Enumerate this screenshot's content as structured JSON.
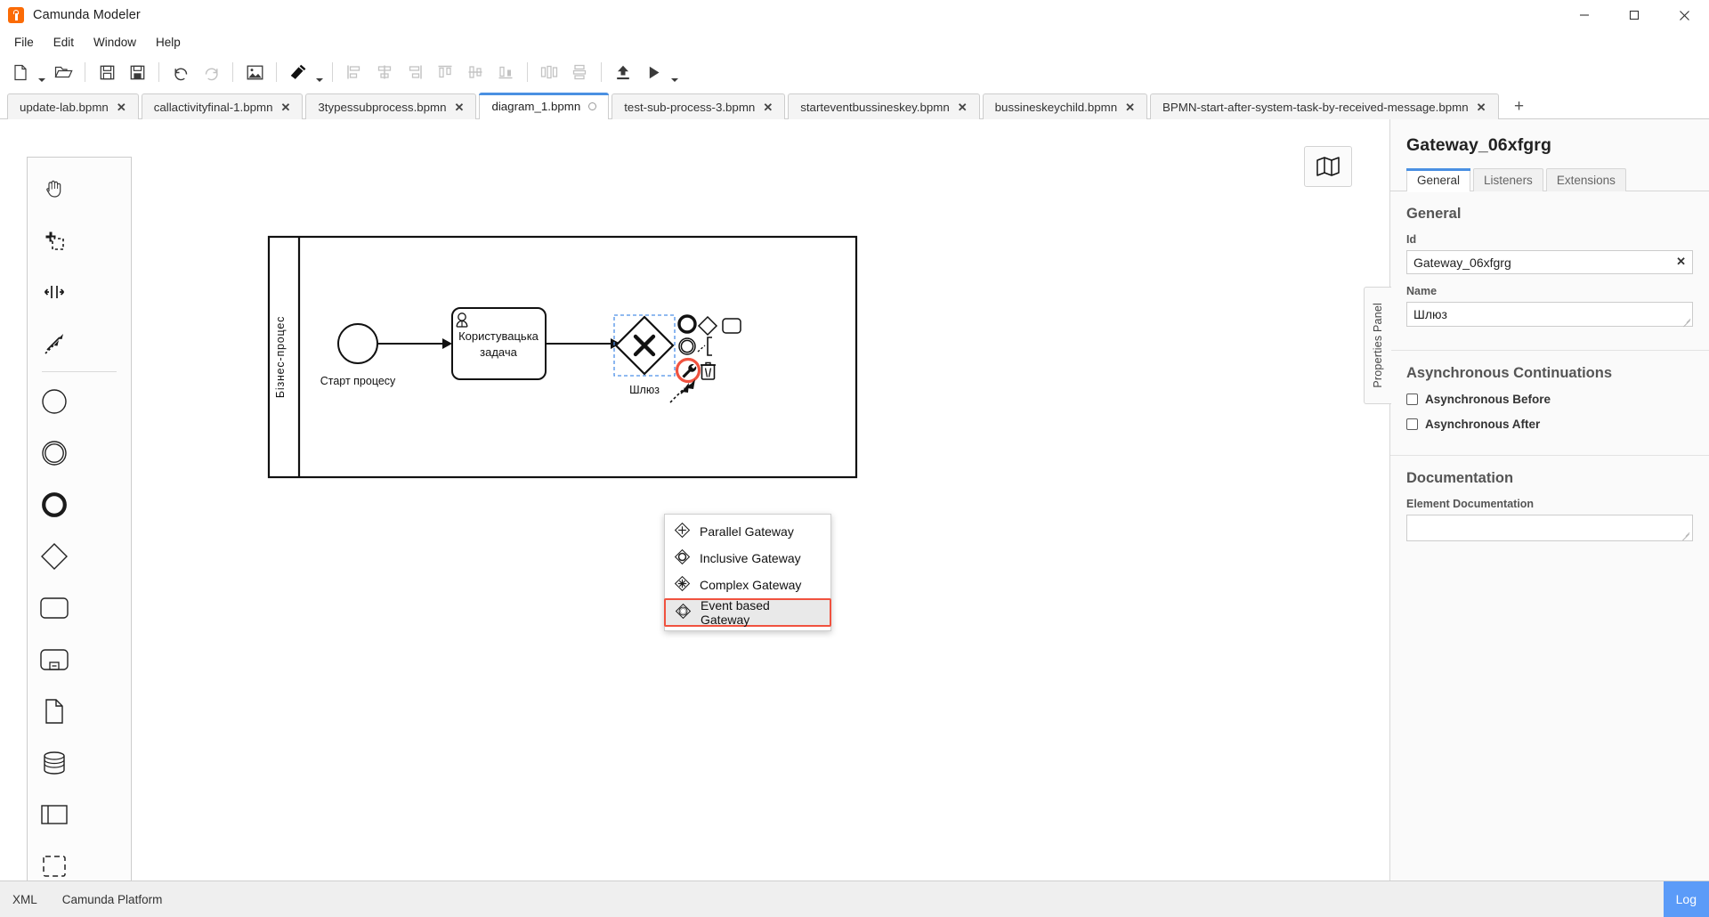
{
  "window": {
    "title": "Camunda Modeler",
    "controls": {
      "minimize": "minimize-button",
      "maximize": "maximize-button",
      "close": "close-button"
    }
  },
  "menu": {
    "items": [
      "File",
      "Edit",
      "Window",
      "Help"
    ]
  },
  "toolbar": {
    "buttons": [
      {
        "name": "new-file-icon",
        "enabled": true,
        "caret": true
      },
      {
        "name": "open-folder-icon",
        "enabled": true,
        "caret": false
      },
      {
        "name": "save-icon",
        "enabled": true,
        "caret": false
      },
      {
        "name": "save-as-icon",
        "enabled": true,
        "caret": false
      },
      {
        "name": "undo-icon",
        "enabled": true,
        "caret": false
      },
      {
        "name": "redo-icon",
        "enabled": false,
        "caret": false
      },
      {
        "name": "export-image-icon",
        "enabled": true,
        "caret": false
      },
      {
        "name": "color-picker-icon",
        "enabled": true,
        "caret": true
      },
      {
        "name": "align-left-icon",
        "enabled": false,
        "caret": false
      },
      {
        "name": "align-center-icon",
        "enabled": false,
        "caret": false
      },
      {
        "name": "align-right-icon",
        "enabled": false,
        "caret": false
      },
      {
        "name": "align-top-icon",
        "enabled": false,
        "caret": false
      },
      {
        "name": "align-middle-icon",
        "enabled": false,
        "caret": false
      },
      {
        "name": "align-bottom-icon",
        "enabled": false,
        "caret": false
      },
      {
        "name": "distribute-horizontal-icon",
        "enabled": false,
        "caret": false
      },
      {
        "name": "distribute-vertical-icon",
        "enabled": false,
        "caret": false
      },
      {
        "name": "deploy-icon",
        "enabled": true,
        "caret": false
      },
      {
        "name": "start-process-icon",
        "enabled": true,
        "caret": true
      }
    ]
  },
  "tabs": {
    "items": [
      {
        "label": "update-lab.bpmn",
        "active": false,
        "dirty": false
      },
      {
        "label": "callactivityfinal-1.bpmn",
        "active": false,
        "dirty": false
      },
      {
        "label": "3typessubprocess.bpmn",
        "active": false,
        "dirty": false
      },
      {
        "label": "diagram_1.bpmn",
        "active": true,
        "dirty": true
      },
      {
        "label": "test-sub-process-3.bpmn",
        "active": false,
        "dirty": false
      },
      {
        "label": "starteventbussineskey.bpmn",
        "active": false,
        "dirty": false
      },
      {
        "label": "bussineskeychild.bpmn",
        "active": false,
        "dirty": false
      },
      {
        "label": "BPMN-start-after-system-task-by-received-message.bpmn",
        "active": false,
        "dirty": false
      }
    ],
    "close_glyph": "✕",
    "new_tab_label": "+"
  },
  "palette": {
    "tools": [
      "hand-tool-icon",
      "lasso-tool-icon",
      "space-tool-icon",
      "connect-tool-icon"
    ],
    "elements": [
      "start-event-icon",
      "intermediate-event-icon",
      "end-event-icon",
      "gateway-icon",
      "task-icon",
      "subprocess-collapsed-icon",
      "data-object-icon",
      "data-store-icon",
      "participant-icon",
      "group-icon"
    ]
  },
  "canvas": {
    "minimap_icon": "minimap-icon",
    "pool_label": "Бізнес-процес",
    "shapes": {
      "start_event_label": "Старт процесу",
      "user_task_label_line1": "Користувацька",
      "user_task_label_line2": "задача",
      "gateway_label": "Шлюз"
    },
    "context_pad": {
      "items": [
        "append-end-event-icon",
        "append-gateway-icon",
        "append-task-icon",
        "append-intermediate-event-icon",
        "append-text-annotation-icon",
        "wrench-change-type-icon",
        "delete-icon",
        "connect-icon"
      ],
      "highlight_color": "#f0523f"
    }
  },
  "popup_menu": {
    "items": [
      {
        "label": "Parallel Gateway",
        "icon": "parallel-gateway-icon",
        "selected": false
      },
      {
        "label": "Inclusive Gateway",
        "icon": "inclusive-gateway-icon",
        "selected": false
      },
      {
        "label": "Complex Gateway",
        "icon": "complex-gateway-icon",
        "selected": false
      },
      {
        "label": "Event based Gateway",
        "icon": "event-based-gateway-icon",
        "selected": true
      }
    ],
    "selection_outline_color": "#f0523f"
  },
  "properties": {
    "handle_label": "Properties Panel",
    "element_title": "Gateway_06xfgrg",
    "tabs": [
      {
        "label": "General",
        "active": true
      },
      {
        "label": "Listeners",
        "active": false
      },
      {
        "label": "Extensions",
        "active": false
      }
    ],
    "general": {
      "group_title": "General",
      "id_label": "Id",
      "id_value": "Gateway_06xfgrg",
      "id_clear_glyph": "✕",
      "name_label": "Name",
      "name_value": "Шлюз"
    },
    "async": {
      "group_title": "Asynchronous Continuations",
      "checkboxes": [
        {
          "label": "Asynchronous Before",
          "checked": false
        },
        {
          "label": "Asynchronous After",
          "checked": false
        }
      ]
    },
    "documentation": {
      "group_title": "Documentation",
      "field_label": "Element Documentation",
      "value": ""
    }
  },
  "statusbar": {
    "left_items": [
      "XML",
      "Camunda Platform"
    ],
    "log_label": "Log",
    "log_color": "#5b9bf8"
  }
}
